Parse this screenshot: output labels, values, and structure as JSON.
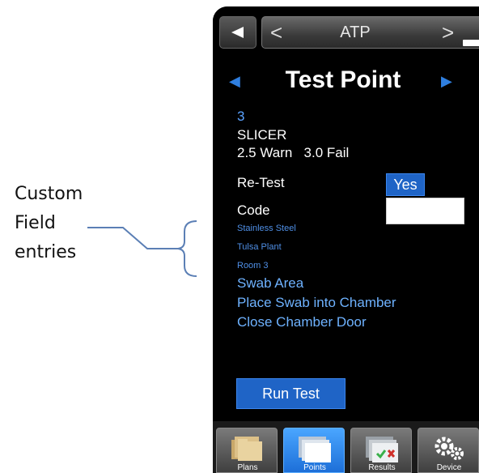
{
  "annotation": {
    "lines": [
      "Custom",
      "Field",
      "entries"
    ]
  },
  "header": {
    "back_icon": "back-arrow-icon",
    "prev_symbol": "<",
    "next_symbol": ">",
    "title": "ATP"
  },
  "page": {
    "prev_symbol": "◀",
    "next_symbol": "▶",
    "title": "Test Point"
  },
  "details": {
    "number": "3",
    "name": "SLICER",
    "limits": "2.5 Warn   3.0 Fail",
    "retest_label": "Re-Test",
    "retest_value": "Yes",
    "code_label": "Code",
    "code_value": "",
    "custom_fields": [
      "Stainless Steel",
      "Tulsa Plant",
      "Room 3"
    ],
    "instructions": [
      "Swab Area",
      "Place Swab into Chamber",
      "Close Chamber Door"
    ]
  },
  "actions": {
    "run_test": "Run Test"
  },
  "tabs": [
    {
      "label": "Plans",
      "icon": "folders-icon"
    },
    {
      "label": "Points",
      "icon": "pages-icon"
    },
    {
      "label": "Results",
      "icon": "results-icon"
    },
    {
      "label": "Device",
      "icon": "gears-icon"
    }
  ],
  "colors": {
    "accent": "#1f64c6",
    "link_blue": "#5aa2ff"
  }
}
